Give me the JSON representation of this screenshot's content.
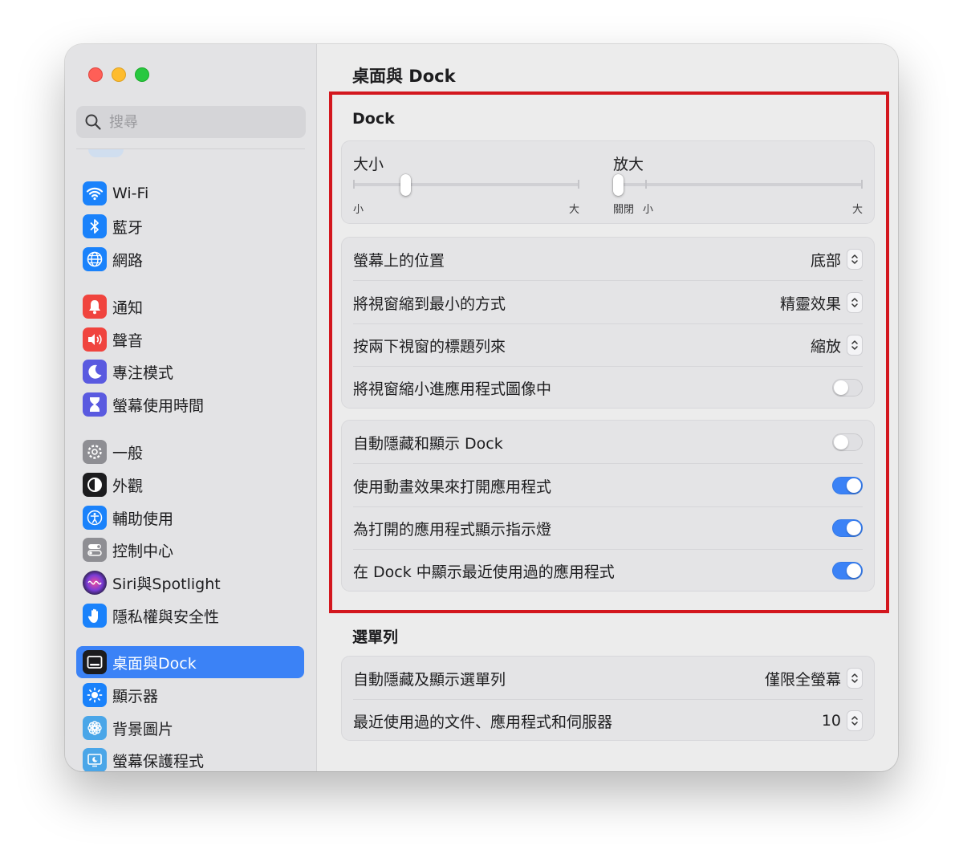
{
  "window": {
    "title": "桌面與 Dock"
  },
  "search": {
    "placeholder": "搜尋",
    "icon": "magnifying-glass-icon"
  },
  "sidebar": {
    "items": [
      {
        "label": "Wi-Fi",
        "icon": "wifi-icon",
        "color": "#1a82fb"
      },
      {
        "label": "藍牙",
        "icon": "bluetooth-icon",
        "color": "#1a82fb"
      },
      {
        "label": "網路",
        "icon": "globe-icon",
        "color": "#1a82fb"
      },
      {
        "label": "通知",
        "icon": "bell-icon",
        "color": "#f0443e"
      },
      {
        "label": "聲音",
        "icon": "speaker-icon",
        "color": "#f0443e"
      },
      {
        "label": "專注模式",
        "icon": "moon-icon",
        "color": "#5a5ae0"
      },
      {
        "label": "螢幕使用時間",
        "icon": "hourglass-icon",
        "color": "#5a5ae0"
      },
      {
        "label": "一般",
        "icon": "gear-icon",
        "color": "#8e8e93"
      },
      {
        "label": "外觀",
        "icon": "appearance-icon",
        "color": "#1c1c1e"
      },
      {
        "label": "輔助使用",
        "icon": "accessibility-icon",
        "color": "#1a82fb"
      },
      {
        "label": "控制中心",
        "icon": "control-center-icon",
        "color": "#8e8e93"
      },
      {
        "label": "Siri與Spotlight",
        "icon": "siri-icon",
        "color": "#7a3cd6"
      },
      {
        "label": "隱私權與安全性",
        "icon": "hand-icon",
        "color": "#1a82fb"
      },
      {
        "label": "桌面與Dock",
        "icon": "dock-icon",
        "color": "#1c1c1e",
        "selected": true
      },
      {
        "label": "顯示器",
        "icon": "sun-icon",
        "color": "#1a82fb"
      },
      {
        "label": "背景圖片",
        "icon": "flower-icon",
        "color": "#4aa6e8"
      },
      {
        "label": "螢幕保護程式",
        "icon": "screensaver-icon",
        "color": "#4aa6e8"
      }
    ]
  },
  "dock_section": {
    "title": "Dock",
    "size": {
      "label": "大小",
      "min_label": "小",
      "max_label": "大",
      "value": 0.22
    },
    "magnification": {
      "label": "放大",
      "off_label": "關閉",
      "min_label": "小",
      "max_label": "大",
      "value": 0.0
    },
    "rows": [
      {
        "label": "螢幕上的位置",
        "type": "popup",
        "value": "底部"
      },
      {
        "label": "將視窗縮到最小的方式",
        "type": "popup",
        "value": "精靈效果"
      },
      {
        "label": "按兩下視窗的標題列來",
        "type": "popup",
        "value": "縮放"
      },
      {
        "label": "將視窗縮小進應用程式圖像中",
        "type": "toggle",
        "on": false
      }
    ],
    "rows2": [
      {
        "label": "自動隱藏和顯示 Dock",
        "type": "toggle",
        "on": false
      },
      {
        "label": "使用動畫效果來打開應用程式",
        "type": "toggle",
        "on": true
      },
      {
        "label": "為打開的應用程式顯示指示燈",
        "type": "toggle",
        "on": true
      },
      {
        "label": "在 Dock 中顯示最近使用過的應用程式",
        "type": "toggle",
        "on": true
      }
    ]
  },
  "menubar_section": {
    "title": "選單列",
    "rows": [
      {
        "label": "自動隱藏及顯示選單列",
        "type": "popup",
        "value": "僅限全螢幕"
      },
      {
        "label": "最近使用過的文件、應用程式和伺服器",
        "type": "popup",
        "value": "10"
      }
    ]
  },
  "colors": {
    "accent": "#3b82f6",
    "highlight_box": "#d3171e"
  }
}
